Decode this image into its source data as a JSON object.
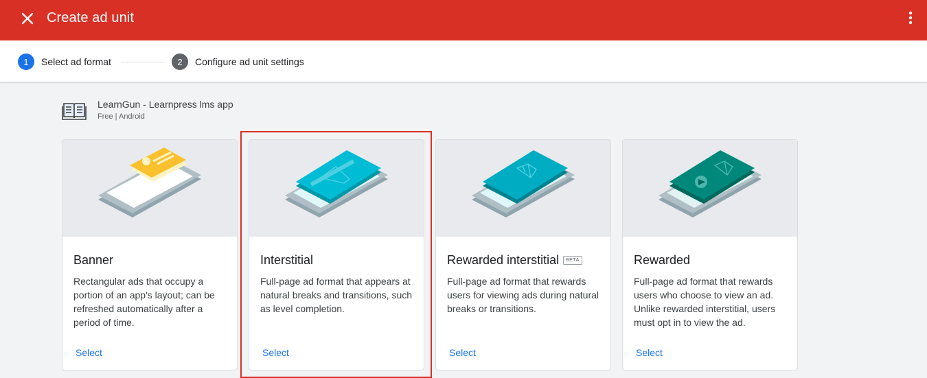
{
  "header": {
    "title": "Create ad unit",
    "bg_color": "#d93025"
  },
  "stepper": {
    "steps": [
      {
        "number": "1",
        "label": "Select ad format",
        "state": "active"
      },
      {
        "number": "2",
        "label": "Configure ad unit settings",
        "state": "inactive"
      }
    ]
  },
  "app": {
    "name": "LearnGun - Learnpress lms app",
    "meta": "Free | Android"
  },
  "formats": [
    {
      "name": "Banner",
      "badge": "",
      "description": "Rectangular ads that occupy a portion of an app's layout; can be refreshed automatically after a period of time.",
      "select_label": "Select"
    },
    {
      "name": "Interstitial",
      "badge": "",
      "description": "Full-page ad format that appears at natural breaks and transitions, such as level completion.",
      "select_label": "Select"
    },
    {
      "name": "Rewarded interstitial",
      "badge": "BETA",
      "description": "Full-page ad format that rewards users for viewing ads during natural breaks or transitions.",
      "select_label": "Select"
    },
    {
      "name": "Rewarded",
      "badge": "",
      "description": "Full-page ad format that rewards users who choose to view an ad. Unlike rewarded interstitial, users must opt in to view the ad.",
      "select_label": "Select"
    }
  ],
  "colors": {
    "accent": "#1a73e8",
    "highlight": "#d93025"
  }
}
